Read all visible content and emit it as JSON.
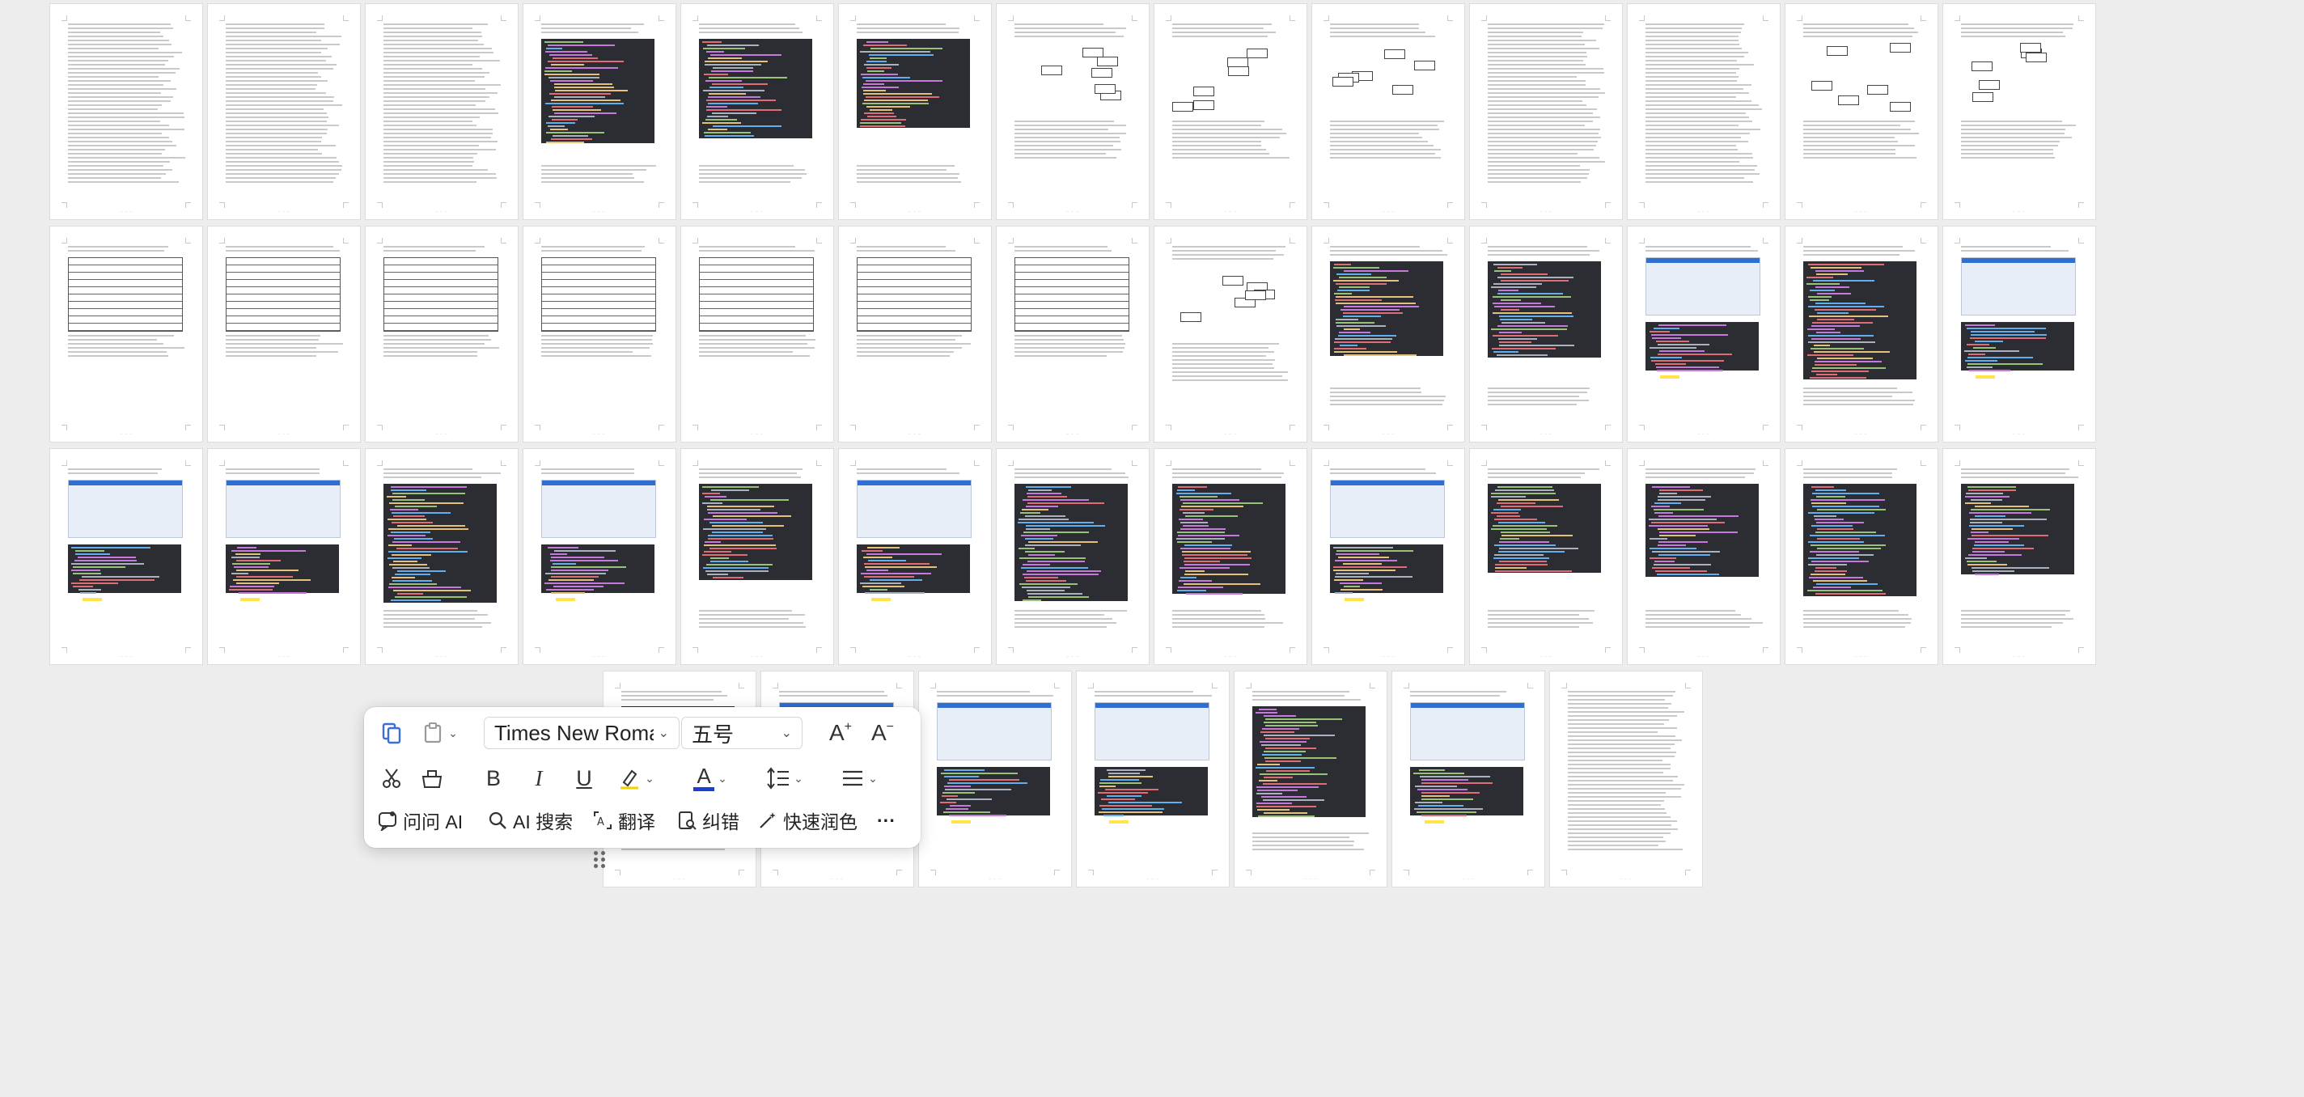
{
  "document": {
    "page_number_placeholder": "— — —",
    "page_count_rows": [
      13,
      13,
      13,
      7
    ]
  },
  "toolbar": {
    "row1": {
      "copy_format_icon": "format-painter-icon",
      "paste_icon": "paste-icon",
      "font_family": "Times New Roman",
      "font_size": "五号",
      "grow_font_label": "A",
      "shrink_font_label": "A"
    },
    "row2": {
      "cut_icon": "scissors-icon",
      "clear_icon": "eraser-icon",
      "bold_label": "B",
      "italic_label": "I",
      "underline_label": "U",
      "highlight_icon": "highlighter-icon",
      "font_color_label": "A",
      "font_color_hex": "#1a3fd6",
      "line_spacing_icon": "line-spacing-icon",
      "align_icon": "align-icon"
    },
    "row3": {
      "ask_ai": "问问 AI",
      "ai_search": "AI 搜索",
      "translate": "翻译",
      "proofread": "纠错",
      "polish": "快速润色",
      "more": "···"
    }
  }
}
